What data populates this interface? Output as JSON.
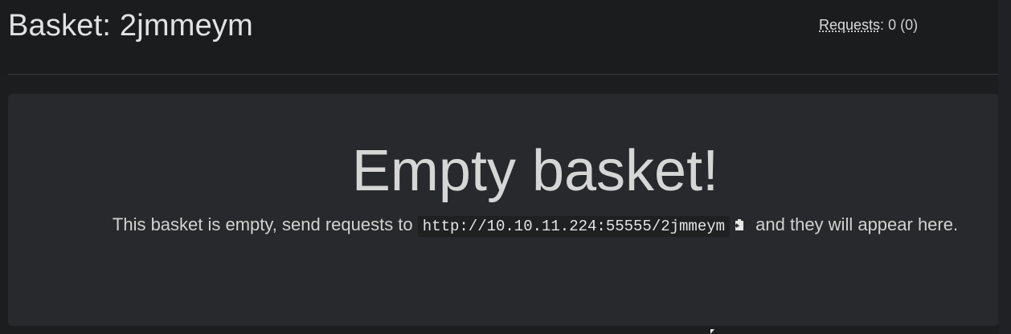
{
  "header": {
    "title": "Basket: 2jmmeym",
    "requests_label": "Requests",
    "requests_sep": ":",
    "requests_value": " 0 (0)"
  },
  "main": {
    "empty_title": "Empty basket!",
    "message_prefix": "This basket is empty, send requests to ",
    "basket_url": "http://10.10.11.224:55555/2jmmeym",
    "message_suffix": " and they will appear here.",
    "copy_icon": "clipboard-copy-icon"
  },
  "colors": {
    "background": "#1c1d1f",
    "panel": "#28292c",
    "text": "#d6d6d6"
  }
}
